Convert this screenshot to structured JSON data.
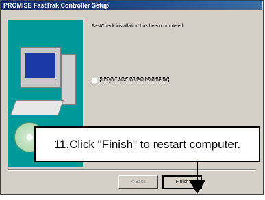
{
  "window": {
    "title": "PROMISE FastTrak Controller Setup"
  },
  "main": {
    "message": "FastCheck installation has been completed.",
    "checkbox_label": "Do you wish to view readme.txt",
    "checkbox_checked": false
  },
  "buttons": {
    "back": "< Back",
    "finish": "Finish"
  },
  "callout": {
    "text": "11.Click \"Finish\" to restart computer."
  }
}
